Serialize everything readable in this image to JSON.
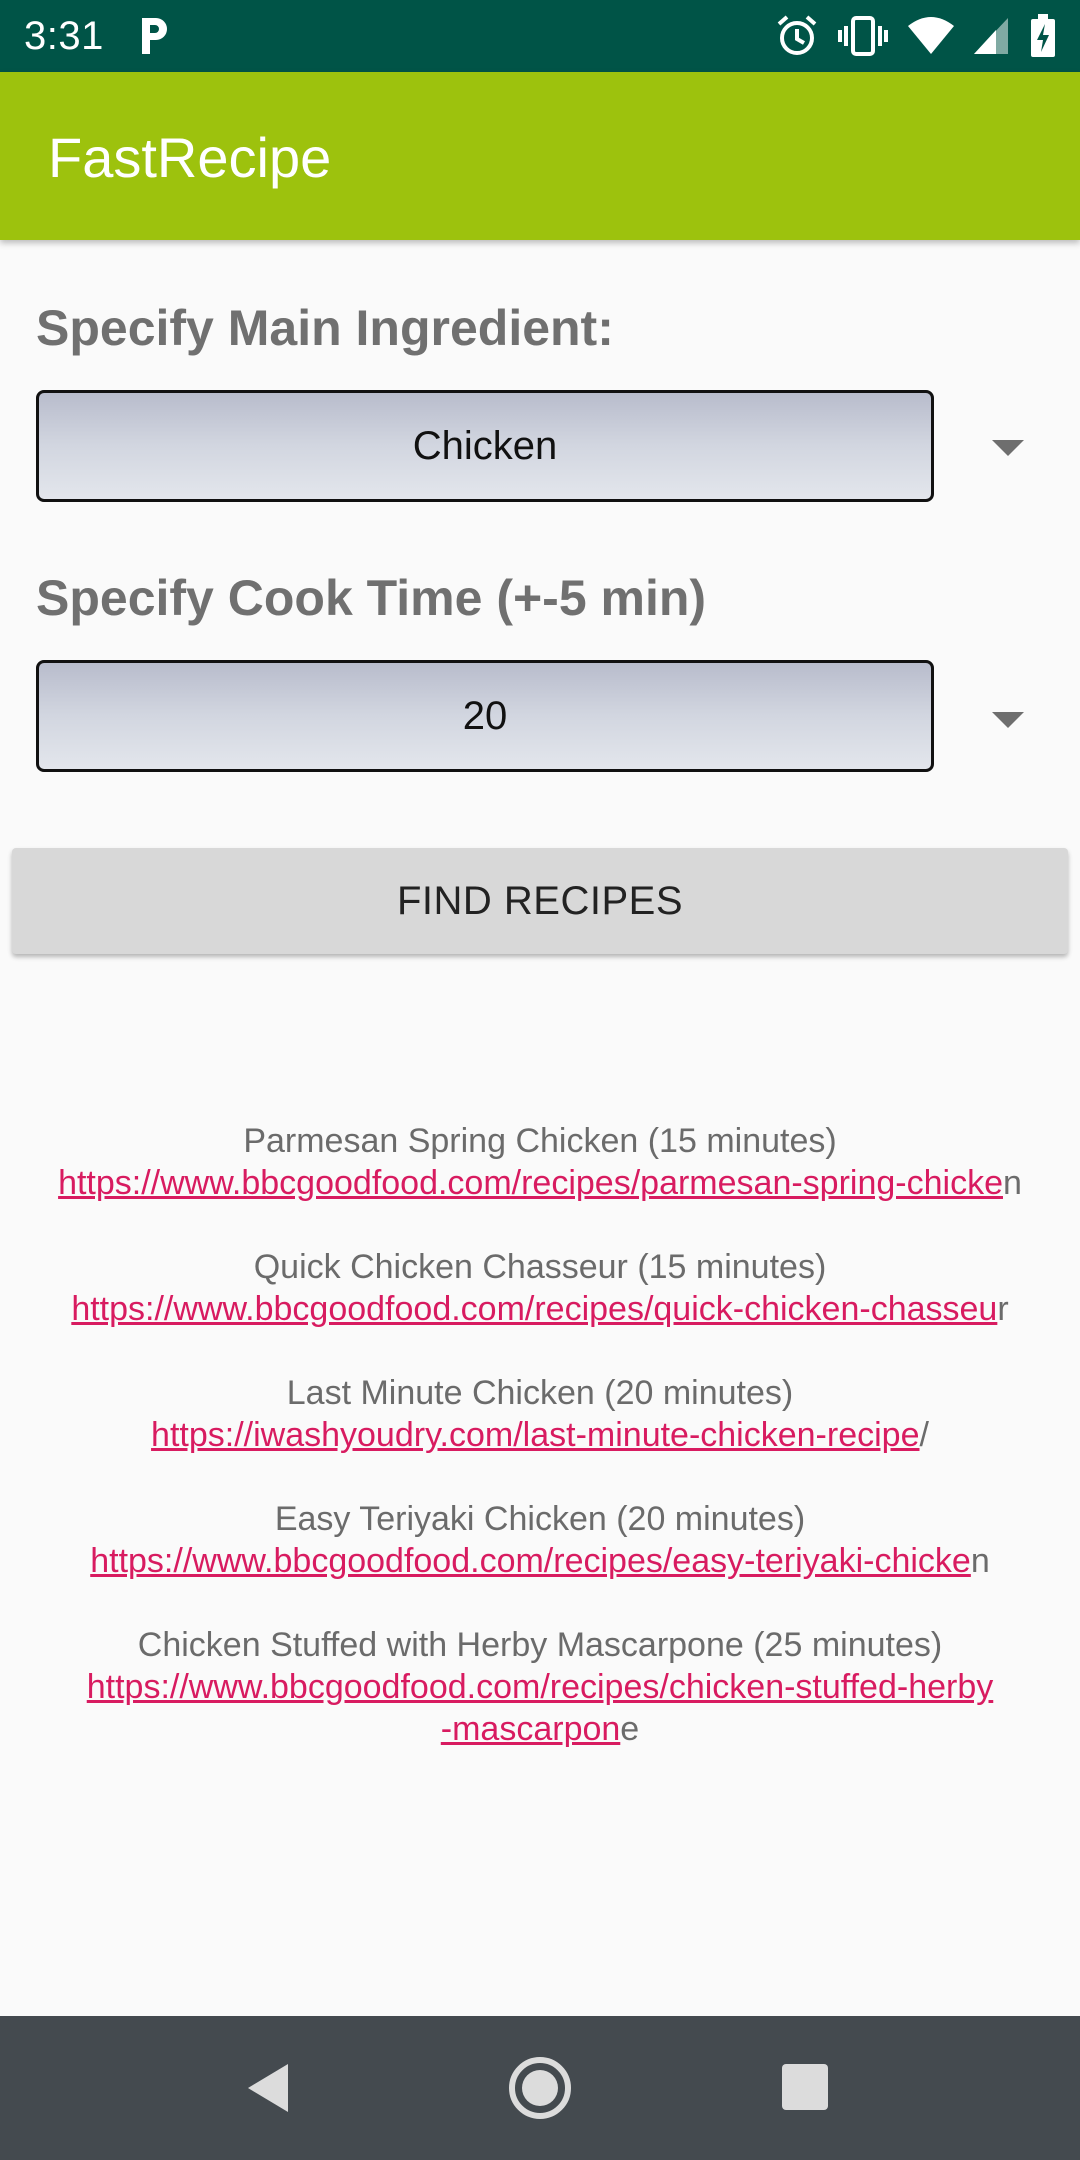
{
  "status_bar": {
    "time": "3:31",
    "left_icons": [
      "parking-icon"
    ],
    "right_icons": [
      "alarm-icon",
      "vibrate-icon",
      "wifi-icon",
      "signal-icon",
      "battery-charging-icon"
    ]
  },
  "app_bar": {
    "title": "FastRecipe",
    "color": "#9dc20d"
  },
  "form": {
    "ingredient_label": "Specify Main Ingredient:",
    "ingredient_value": "Chicken",
    "cook_time_label": "Specify Cook Time (+-5 min)",
    "cook_time_value": "20",
    "find_button_label": "FIND RECIPES"
  },
  "results": [
    {
      "title": "Parmesan Spring Chicken (15 minutes)",
      "link": "https://www.bbcgoodfood.com/recipes/parmesan-spring-chicke",
      "tail": "n"
    },
    {
      "title": "Quick Chicken Chasseur (15 minutes)",
      "link": "https://www.bbcgoodfood.com/recipes/quick-chicken-chasseu",
      "tail": "r"
    },
    {
      "title": "Last Minute Chicken (20 minutes)",
      "link": "https://iwashyoudry.com/last-minute-chicken-recipe",
      "tail": "/"
    },
    {
      "title": "Easy Teriyaki Chicken (20 minutes)",
      "link": "https://www.bbcgoodfood.com/recipes/easy-teriyaki-chicke",
      "tail": "n"
    },
    {
      "title": "Chicken Stuffed with Herby Mascarpone (25 minutes)",
      "link_line1": "https://www.bbcgoodfood.com/recipes/chicken-stuffed-herby",
      "link_line2": "-mascarpon",
      "tail": "e"
    }
  ],
  "nav_bar": {
    "buttons": [
      "back-icon",
      "home-icon",
      "recents-icon"
    ]
  },
  "colors": {
    "status_bar": "#005447",
    "link": "#d81b60",
    "label_gray": "#707070"
  }
}
